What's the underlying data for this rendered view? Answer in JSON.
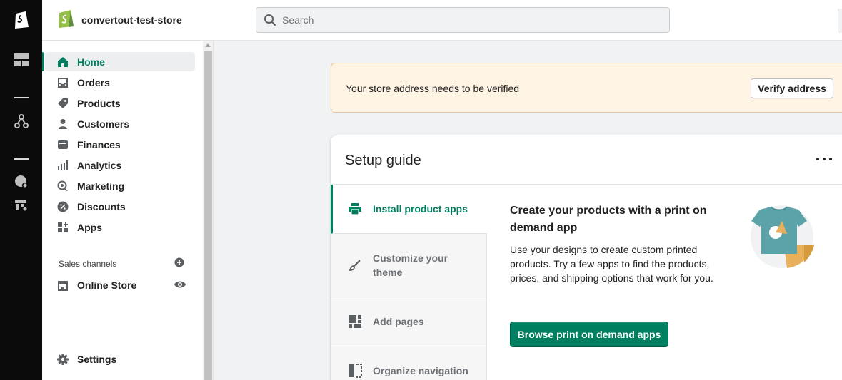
{
  "topbar": {
    "store_name": "convertout-test-store",
    "search_placeholder": "Search"
  },
  "rail": {
    "icons": [
      "shopify-logo-icon",
      "dashboard-icon",
      "organization-icon",
      "store-settings-icon",
      "apps-settings-icon"
    ]
  },
  "sidebar": {
    "items": [
      {
        "label": "Home",
        "icon": "home-icon",
        "active": true
      },
      {
        "label": "Orders",
        "icon": "orders-icon"
      },
      {
        "label": "Products",
        "icon": "tag-icon"
      },
      {
        "label": "Customers",
        "icon": "person-icon"
      },
      {
        "label": "Finances",
        "icon": "wallet-icon"
      },
      {
        "label": "Analytics",
        "icon": "bar-chart-icon"
      },
      {
        "label": "Marketing",
        "icon": "marketing-icon"
      },
      {
        "label": "Discounts",
        "icon": "discount-icon"
      },
      {
        "label": "Apps",
        "icon": "apps-icon"
      }
    ],
    "sales_channels_title": "Sales channels",
    "online_store_label": "Online Store",
    "settings_label": "Settings"
  },
  "banner": {
    "text": "Your store address needs to be verified",
    "button_label": "Verify address"
  },
  "setup_guide": {
    "title": "Setup guide",
    "steps": [
      {
        "label": "Install product apps",
        "icon": "printer-icon",
        "active": true
      },
      {
        "label": "Customize your theme",
        "icon": "brush-icon"
      },
      {
        "label": "Add pages",
        "icon": "pages-icon"
      },
      {
        "label": "Organize navigation",
        "icon": "navigation-icon"
      }
    ],
    "detail_title": "Create your products with a print on demand app",
    "detail_description": "Use your designs to create custom printed products. Try a few apps to find the products, prices, and shipping options that work for you.",
    "primary_button_label": "Browse print on demand apps"
  },
  "colors": {
    "accent_green": "#008060",
    "banner_bg": "#fff4e4",
    "rail_bg": "#0b0b0b"
  }
}
